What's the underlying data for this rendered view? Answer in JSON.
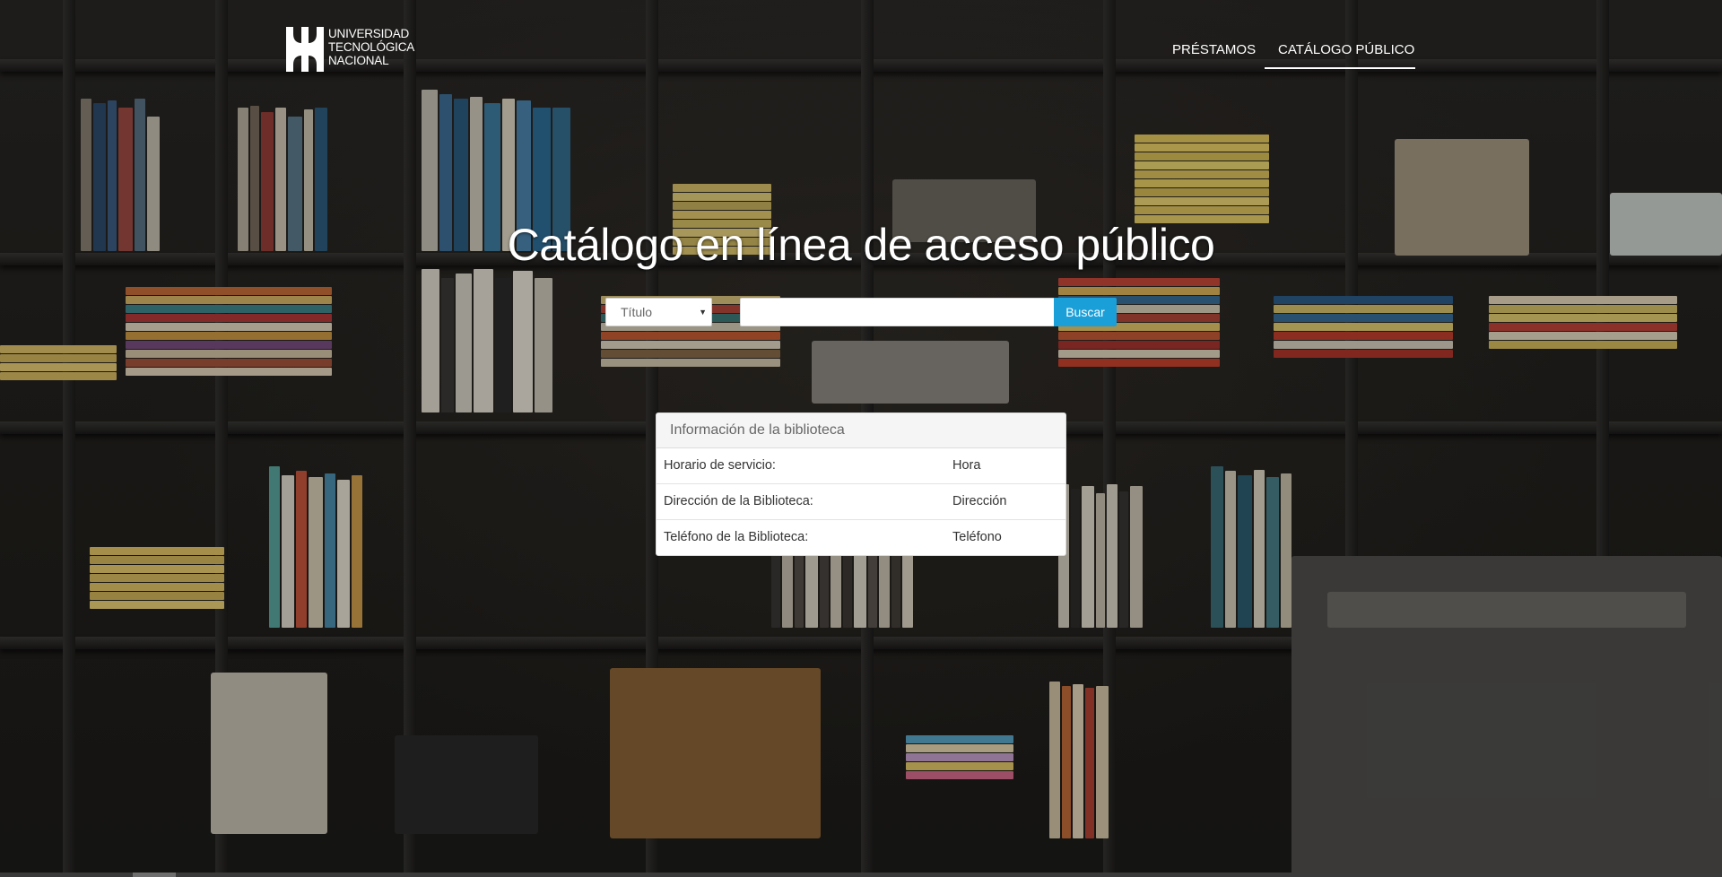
{
  "header": {
    "logo_lines": [
      "UNIVERSIDAD",
      "TECNOLÓGICA",
      "NACIONAL"
    ],
    "nav": [
      {
        "label": "PRÉSTAMOS",
        "active": false
      },
      {
        "label": "CATÁLOGO PÚBLICO",
        "active": true
      }
    ]
  },
  "hero": {
    "title": "Catálogo en línea de acceso público"
  },
  "search": {
    "field_selected": "Título",
    "query_value": "",
    "button_label": "Buscar",
    "accent_color": "#1b9fd8"
  },
  "info": {
    "heading": "Información de la biblioteca",
    "rows": [
      {
        "label": "Horario de servicio:",
        "value": "Hora"
      },
      {
        "label": "Dirección de la Biblioteca:",
        "value": "Dirección"
      },
      {
        "label": "Teléfono de la Biblioteca:",
        "value": "Teléfono"
      }
    ]
  },
  "icons": {
    "logo": "utn-logo-icon",
    "select_arrow": "caret-down-icon"
  }
}
